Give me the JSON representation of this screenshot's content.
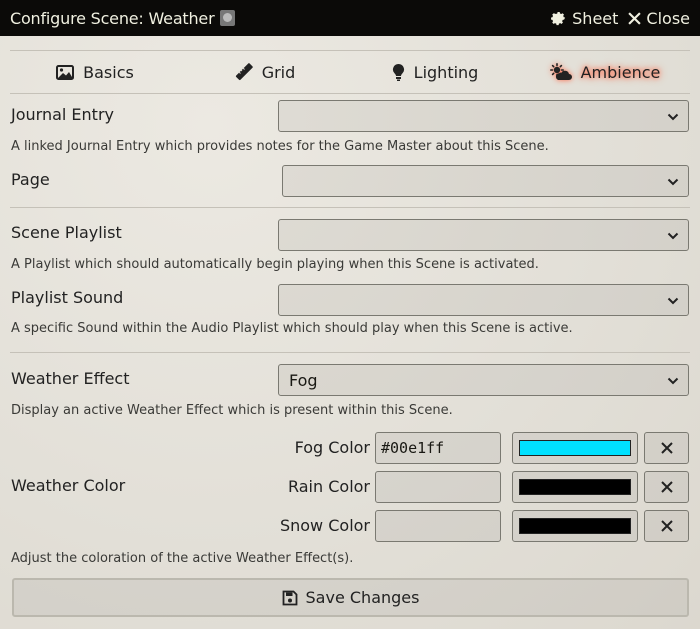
{
  "window": {
    "title": "Configure Scene: Weather",
    "sheet_label": "Sheet",
    "close_label": "Close"
  },
  "tabs": [
    {
      "label": "Basics",
      "icon": "image-icon",
      "active": false
    },
    {
      "label": "Grid",
      "icon": "ruler-icon",
      "active": false
    },
    {
      "label": "Lighting",
      "icon": "lightbulb-icon",
      "active": false
    },
    {
      "label": "Ambience",
      "icon": "cloud-sun-icon",
      "active": true
    }
  ],
  "journal": {
    "label": "Journal Entry",
    "value": "",
    "hint": "A linked Journal Entry which provides notes for the Game Master about this Scene.",
    "page_label": "Page",
    "page_value": ""
  },
  "playlist": {
    "label": "Scene Playlist",
    "value": "",
    "hint": "A Playlist which should automatically begin playing when this Scene is activated.",
    "sound_label": "Playlist Sound",
    "sound_value": "",
    "sound_hint": "A specific Sound within the Audio Playlist which should play when this Scene is active."
  },
  "weather": {
    "label": "Weather Effect",
    "value": "Fog",
    "hint": "Display an active Weather Effect which is present within this Scene.",
    "color_label": "Weather Color",
    "colors": [
      {
        "label": "Fog Color",
        "value": "#00e1ff",
        "swatch": "#00e1ff"
      },
      {
        "label": "Rain Color",
        "value": "",
        "swatch": "#000000"
      },
      {
        "label": "Snow Color",
        "value": "",
        "swatch": "#000000"
      }
    ],
    "color_hint": "Adjust the coloration of the active Weather Effect(s)."
  },
  "save_label": "Save Changes",
  "accent": "#ff5a3a"
}
